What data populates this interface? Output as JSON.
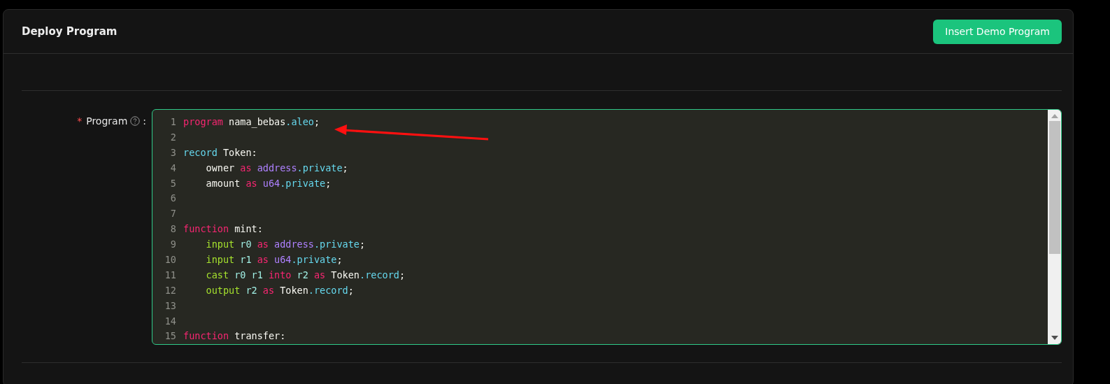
{
  "card": {
    "title": "Deploy Program",
    "action_button": "Insert Demo Program"
  },
  "form": {
    "field_label": "Program",
    "required_mark": "*",
    "separator": ":",
    "lines": [
      {
        "number": "1",
        "tokens": [
          {
            "kind": "keyword",
            "text": "program"
          },
          {
            "kind": "plain",
            "text": " nama_bebas"
          },
          {
            "kind": "suffix",
            "text": ".aleo"
          },
          {
            "kind": "plain",
            "text": ";"
          }
        ]
      },
      {
        "number": "2"
      },
      {
        "number": "3",
        "tokens": [
          {
            "kind": "decl",
            "text": "record"
          },
          {
            "kind": "plain",
            "text": " Token:"
          }
        ]
      },
      {
        "number": "4",
        "tokens": [
          {
            "kind": "plain",
            "text": "    owner "
          },
          {
            "kind": "keyword",
            "text": "as"
          },
          {
            "kind": "type",
            "text": " address"
          },
          {
            "kind": "suffix",
            "text": ".private"
          },
          {
            "kind": "plain",
            "text": ";"
          }
        ]
      },
      {
        "number": "5",
        "tokens": [
          {
            "kind": "plain",
            "text": "    amount "
          },
          {
            "kind": "keyword",
            "text": "as"
          },
          {
            "kind": "type",
            "text": " u64"
          },
          {
            "kind": "suffix",
            "text": ".private"
          },
          {
            "kind": "plain",
            "text": ";"
          }
        ]
      },
      {
        "number": "6"
      },
      {
        "number": "7"
      },
      {
        "number": "8",
        "tokens": [
          {
            "kind": "keyword",
            "text": "function"
          },
          {
            "kind": "plain",
            "text": " mint:"
          }
        ]
      },
      {
        "number": "9",
        "tokens": [
          {
            "kind": "opcode",
            "text": "    input"
          },
          {
            "kind": "register",
            "text": " r0 "
          },
          {
            "kind": "keyword",
            "text": "as"
          },
          {
            "kind": "type",
            "text": " address"
          },
          {
            "kind": "suffix",
            "text": ".private"
          },
          {
            "kind": "plain",
            "text": ";"
          }
        ]
      },
      {
        "number": "10",
        "tokens": [
          {
            "kind": "opcode",
            "text": "    input"
          },
          {
            "kind": "register",
            "text": " r1 "
          },
          {
            "kind": "keyword",
            "text": "as"
          },
          {
            "kind": "type",
            "text": " u64"
          },
          {
            "kind": "suffix",
            "text": ".private"
          },
          {
            "kind": "plain",
            "text": ";"
          }
        ]
      },
      {
        "number": "11",
        "tokens": [
          {
            "kind": "opcode",
            "text": "    cast"
          },
          {
            "kind": "register",
            "text": " r0 r1 "
          },
          {
            "kind": "keyword",
            "text": "into"
          },
          {
            "kind": "register",
            "text": " r2 "
          },
          {
            "kind": "keyword",
            "text": "as"
          },
          {
            "kind": "plain",
            "text": " Token"
          },
          {
            "kind": "suffix",
            "text": ".record"
          },
          {
            "kind": "plain",
            "text": ";"
          }
        ]
      },
      {
        "number": "12",
        "tokens": [
          {
            "kind": "opcode",
            "text": "    output"
          },
          {
            "kind": "register",
            "text": " r2 "
          },
          {
            "kind": "keyword",
            "text": "as"
          },
          {
            "kind": "plain",
            "text": " Token"
          },
          {
            "kind": "suffix",
            "text": ".record"
          },
          {
            "kind": "plain",
            "text": ";"
          }
        ]
      },
      {
        "number": "13"
      },
      {
        "number": "14"
      },
      {
        "number": "15",
        "tokens": [
          {
            "kind": "keyword",
            "text": "function"
          },
          {
            "kind": "plain",
            "text": " transfer:"
          }
        ]
      }
    ]
  }
}
